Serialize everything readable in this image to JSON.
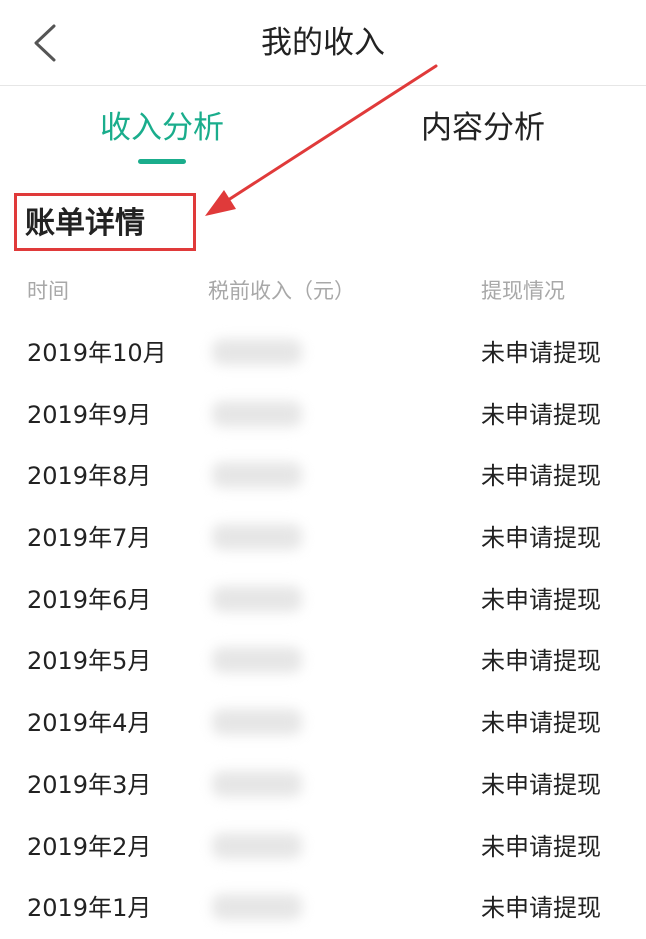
{
  "header": {
    "title": "我的收入",
    "back_icon": "chevron-left-icon"
  },
  "tabs": [
    {
      "label": "收入分析",
      "active": true
    },
    {
      "label": "内容分析",
      "active": false
    }
  ],
  "colors": {
    "accent": "#1aad8c",
    "annotation": "#e03a3a",
    "header_text": "#a8a8a8"
  },
  "section": {
    "title": "账单详情"
  },
  "table": {
    "columns": [
      "时间",
      "税前收入（元）",
      "提现情况"
    ],
    "rows": [
      {
        "date": "2019年10月",
        "status": "未申请提现"
      },
      {
        "date": "2019年9月",
        "status": "未申请提现"
      },
      {
        "date": "2019年8月",
        "status": "未申请提现"
      },
      {
        "date": "2019年7月",
        "status": "未申请提现"
      },
      {
        "date": "2019年6月",
        "status": "未申请提现"
      },
      {
        "date": "2019年5月",
        "status": "未申请提现"
      },
      {
        "date": "2019年4月",
        "status": "未申请提现"
      },
      {
        "date": "2019年3月",
        "status": "未申请提现"
      },
      {
        "date": "2019年2月",
        "status": "未申请提现"
      },
      {
        "date": "2019年1月",
        "status": "未申请提现"
      }
    ]
  }
}
